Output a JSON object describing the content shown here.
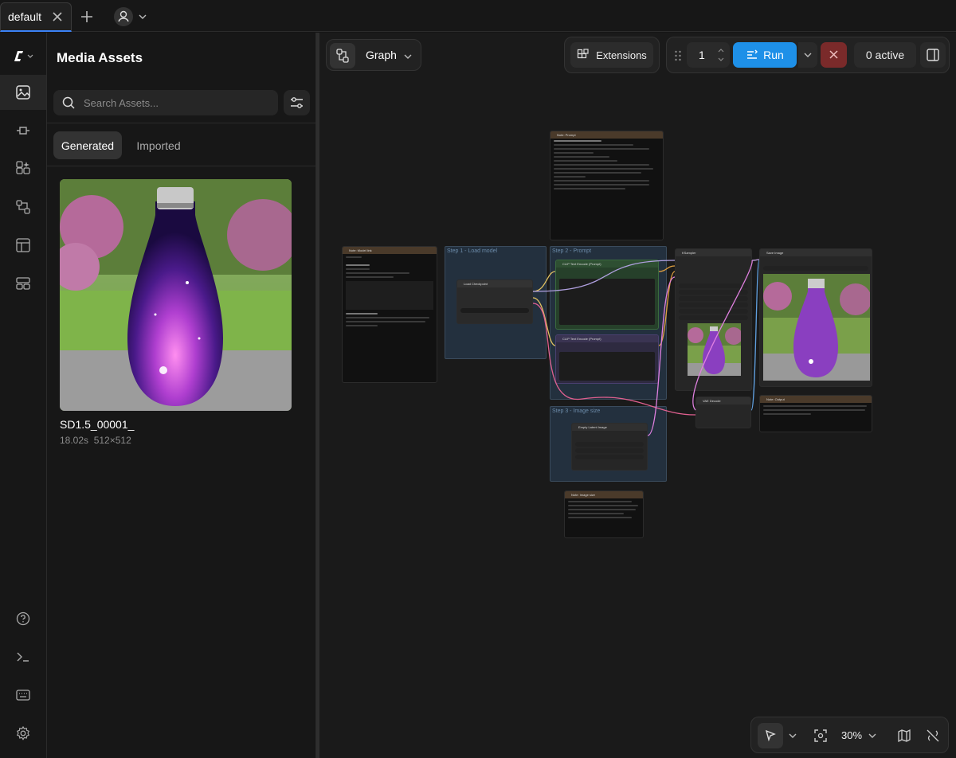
{
  "tabs": {
    "active_label": "default"
  },
  "assets_panel": {
    "title": "Media Assets",
    "search_placeholder": "Search Assets...",
    "tabs": [
      "Generated",
      "Imported"
    ],
    "assets": [
      {
        "name": "SD1.5_00001_",
        "duration": "18.02s",
        "dimensions": "512×512"
      }
    ]
  },
  "canvas_toolbar": {
    "view_label": "Graph",
    "extensions_label": "Extensions",
    "queue_count": "1",
    "run_label": "Run",
    "active_label": "0 active"
  },
  "bottom_toolbar": {
    "zoom": "30%"
  },
  "graph": {
    "groups": [
      "Step 1 - Load model",
      "Step 2 - Prompt",
      "Step 3 - Image size"
    ],
    "nodes": {
      "note_prompt": "Note: Prompt",
      "note_model": "Note: Model link",
      "load_checkpoint": "Load Checkpoint",
      "clip_pos": "CLIP Text Encode (Prompt)",
      "clip_neg": "CLIP Text Encode (Prompt)",
      "ksampler": "KSampler",
      "save_image": "Save Image",
      "vae_decode": "VAE Decode",
      "empty_latent": "Empty Latent Image",
      "note_output": "Note: Output",
      "note_image_size": "Note: Image size"
    }
  },
  "colors": {
    "accent": "#1e90e8",
    "cancel": "#7a2a2a",
    "tab_underline": "#3b82f6"
  },
  "icons": [
    "close-icon",
    "plus-icon",
    "user-icon",
    "chevron-down-icon",
    "logo-icon",
    "images-icon",
    "plug-icon",
    "sparkles-icon",
    "workflow-icon",
    "template-icon",
    "layout-icon",
    "help-icon",
    "terminal-icon",
    "keyboard-icon",
    "gear-icon",
    "search-icon",
    "sliders-icon",
    "puzzle-icon",
    "drag-icon",
    "panel-icon",
    "cursor-icon",
    "fit-icon",
    "map-icon",
    "unlink-icon"
  ]
}
